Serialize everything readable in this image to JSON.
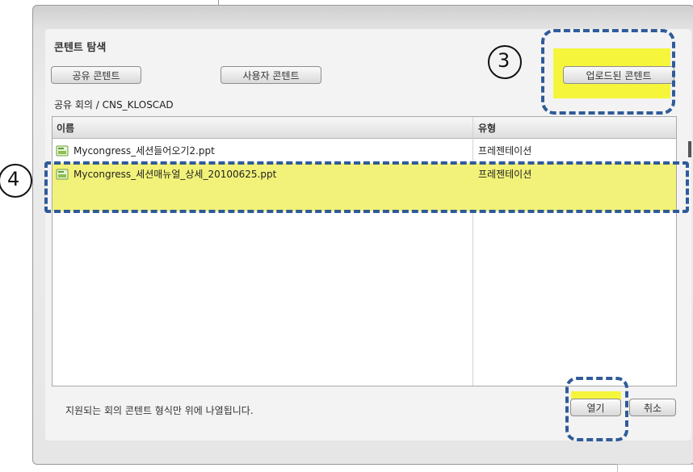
{
  "dialog": {
    "title": "콘텐트 탐색",
    "buttons": {
      "shared": "공유 콘텐트",
      "user": "사용자 콘텐트",
      "uploaded": "업로드된 콘텐트",
      "open": "열기",
      "cancel": "취소"
    },
    "breadcrumb": "공유 회의 / CNS_KLOSCAD",
    "grid": {
      "columns": [
        "이름",
        "유형"
      ],
      "rows": [
        {
          "name": "Mycongress_세션들어오기2.ppt",
          "type": "프레젠테이션",
          "icon": "ppt-file-icon",
          "selected": false
        },
        {
          "name": "Mycongress_세션매뉴얼_상세_20100625.ppt",
          "type": "프레젠테이션",
          "icon": "ppt-file-icon",
          "selected": true
        }
      ]
    },
    "footer_note": "지원되는 회의 콘텐트 형식만 위에 나열됩니다."
  },
  "annotations": {
    "callout_3": "3",
    "callout_4": "4",
    "highlight_color": "#f4f41a",
    "dash_color": "#2f5b9a"
  }
}
